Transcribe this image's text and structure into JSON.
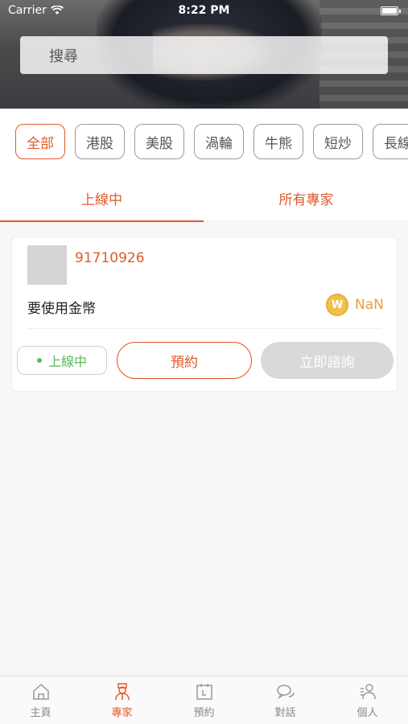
{
  "status_bar": {
    "carrier": "Carrier",
    "time": "8:22 PM"
  },
  "search": {
    "placeholder": "搜尋"
  },
  "categories": [
    "全部",
    "港股",
    "美股",
    "渦輪",
    "牛熊",
    "短炒",
    "長線"
  ],
  "active_category": "全部",
  "tabs": [
    {
      "label": "上線中",
      "active": true
    },
    {
      "label": "所有專家",
      "active": false
    }
  ],
  "expert_card": {
    "id": "91710926",
    "coin_note": "要使用金幣",
    "coin_icon": "W",
    "coin_value": "NaN",
    "status": "上線中",
    "book_label": "預約",
    "consult_label": "立即諮詢"
  },
  "tabbar": [
    {
      "label": "主頁",
      "icon": "home-icon"
    },
    {
      "label": "專家",
      "icon": "expert-icon",
      "active": true
    },
    {
      "label": "預約",
      "icon": "calendar-icon"
    },
    {
      "label": "對話",
      "icon": "chat-icon"
    },
    {
      "label": "個人",
      "icon": "profile-icon"
    }
  ],
  "colors": {
    "accent": "#e05a2b",
    "online": "#5cb85c",
    "coin": "#f0c14b"
  }
}
